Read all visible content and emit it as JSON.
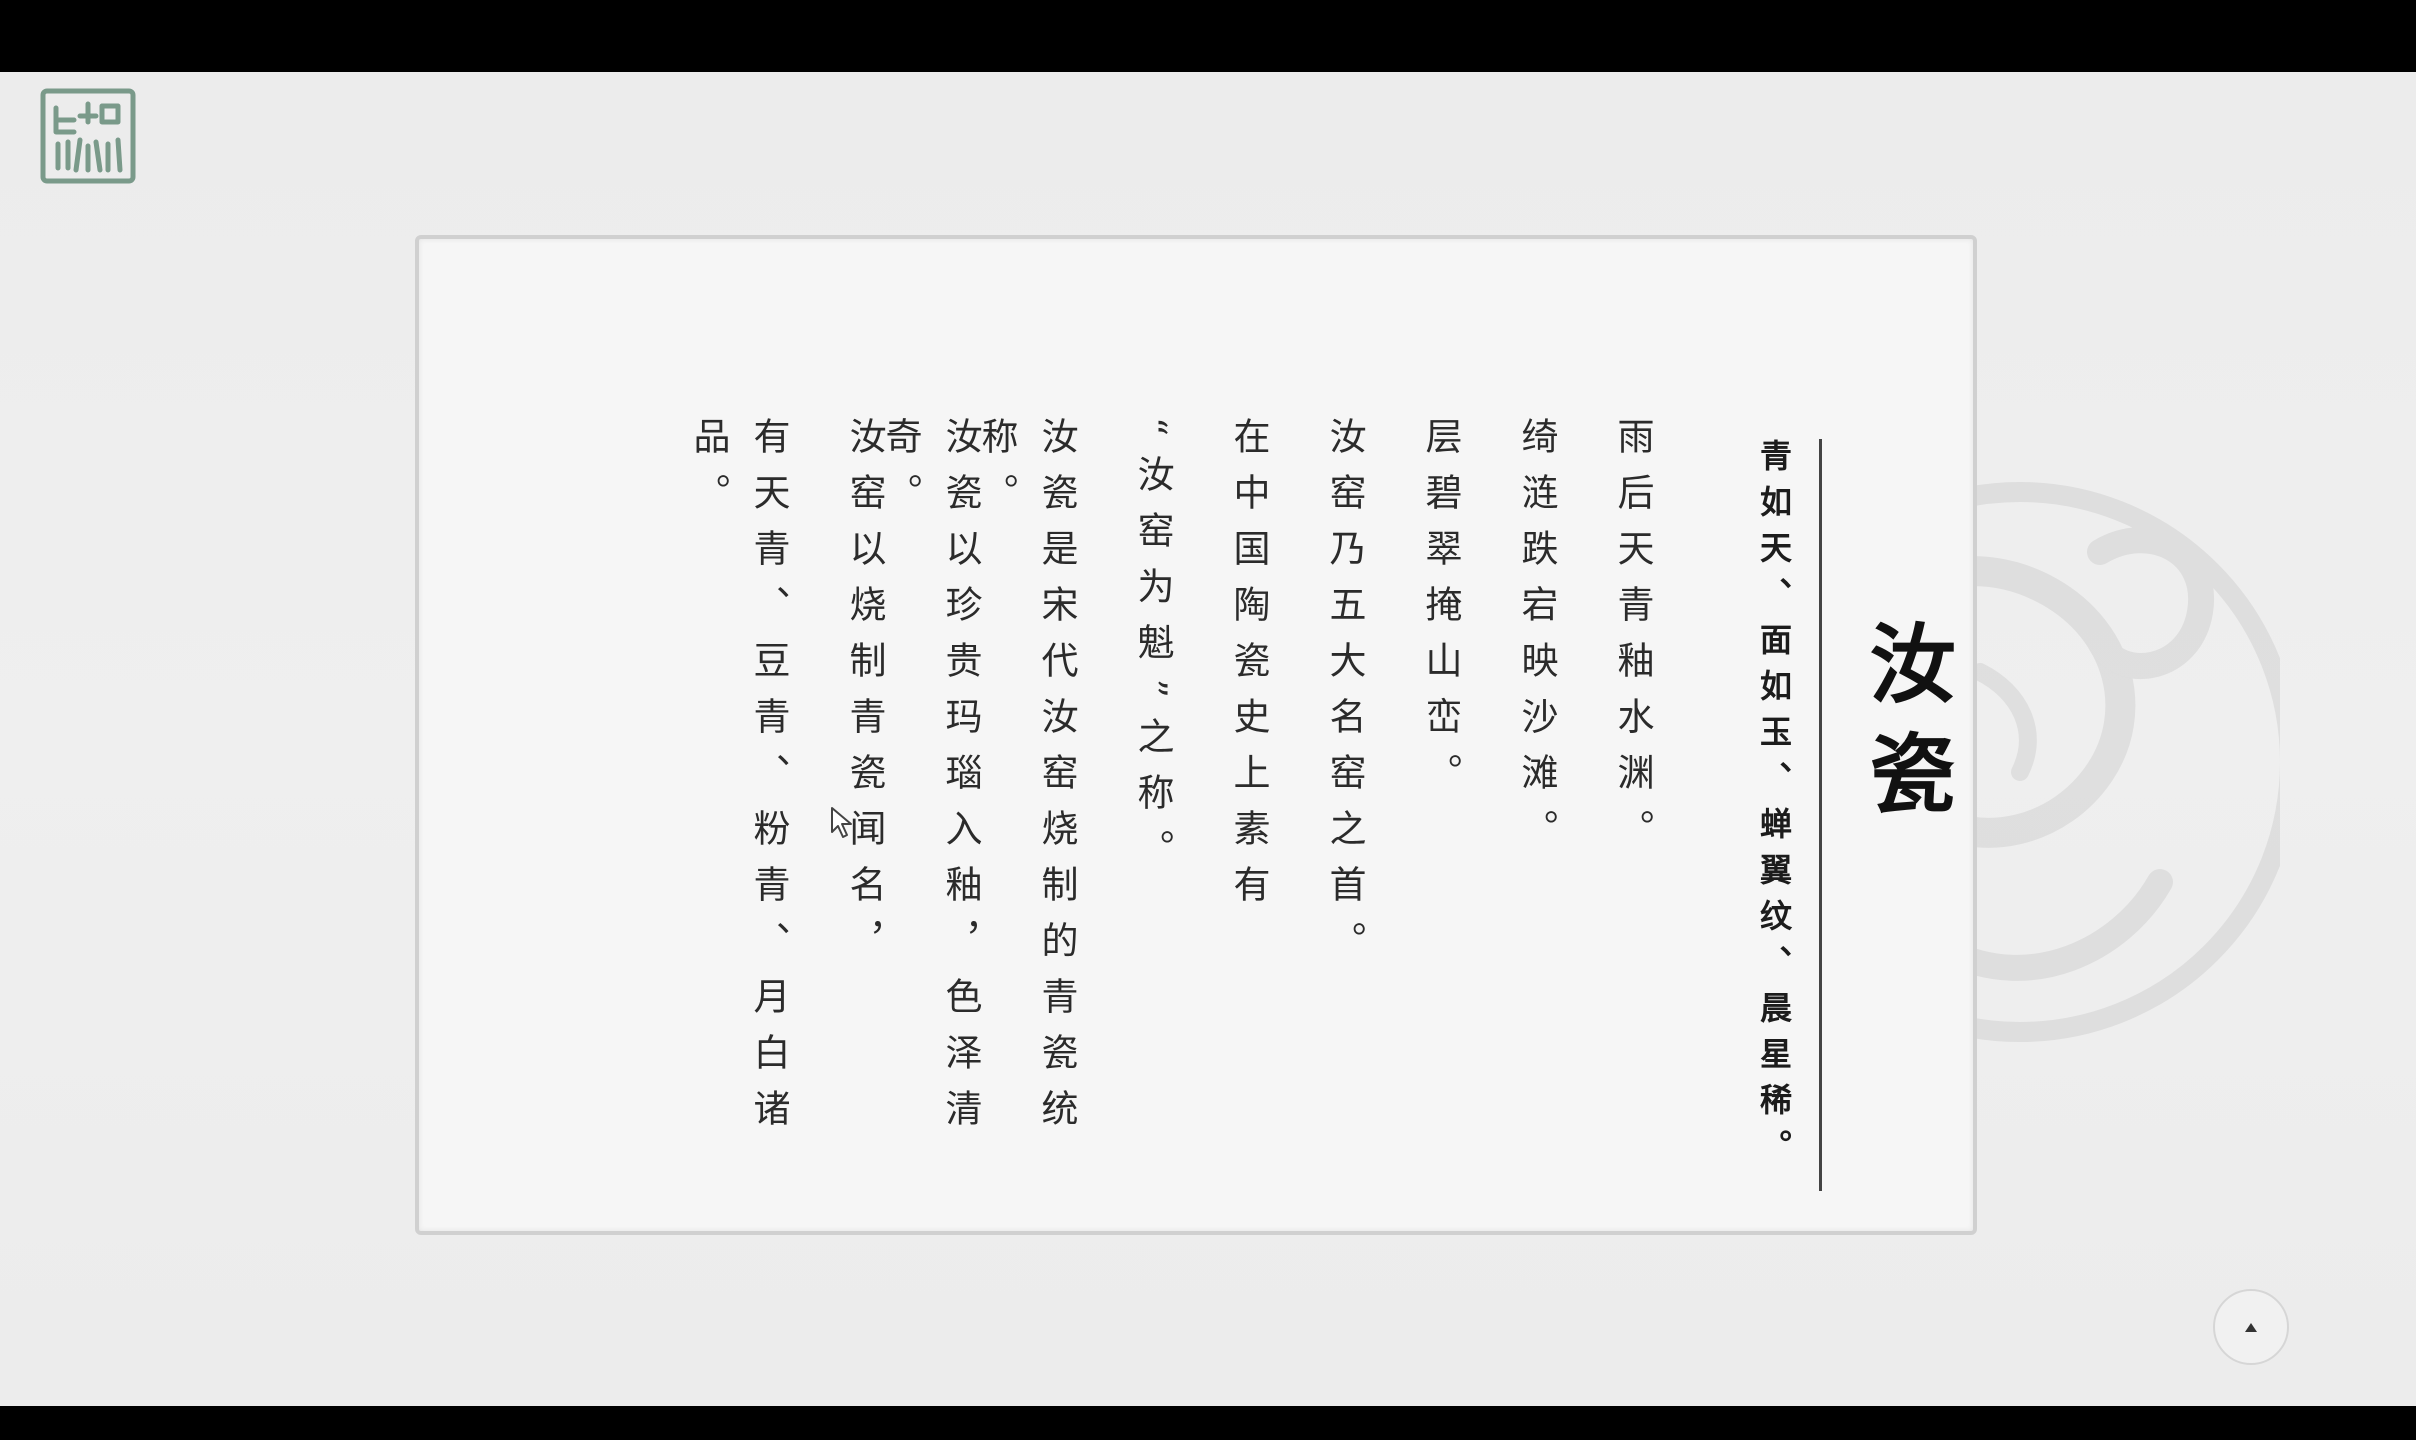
{
  "logo": {
    "icon": "ru-seal-logo-icon",
    "color": "#7a9a8a"
  },
  "article": {
    "title": "汝瓷",
    "subtitle": "青如天、面如玉、蝉翼纹、晨星稀。",
    "columns": [
      "雨后天青釉水渊。",
      "绮涟跌宕映沙滩。",
      "层碧翠掩山峦。",
      "汝窑乃五大名窑之首。",
      "在中国陶瓷史上素有",
      "“汝窑为魁”之称。",
      "汝瓷是宋代汝窑烧制的青瓷统称。",
      "汝瓷以珍贵玛瑙入釉，色泽清奇。",
      "汝窑以烧制青瓷闻名，",
      "有天青、豆青、粉青、月白诸品。"
    ]
  },
  "scroll_top": {
    "icon": "arrow-up-icon"
  },
  "watermark": {
    "icon": "phoenix-seal-icon"
  },
  "cursor": {
    "icon": "mouse-pointer-icon"
  }
}
